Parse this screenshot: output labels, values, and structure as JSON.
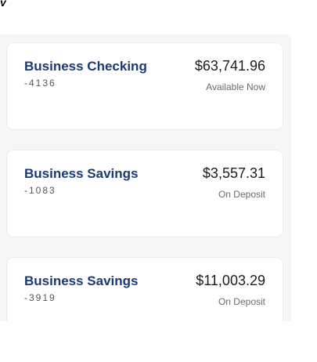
{
  "colors": {
    "account_name": "#1b3a73",
    "amount": "#1c1c1c",
    "muted": "#6c6c6c",
    "panel_bg": "#f6f6f7",
    "card_bg": "#ffffff"
  },
  "accounts": [
    {
      "name": "Business Checking",
      "number": "-4136",
      "amount": "$63,741.96",
      "status": "Available Now"
    },
    {
      "name": "Business Savings",
      "number": "-1083",
      "amount": "$3,557.31",
      "status": "On Deposit"
    },
    {
      "name": "Business Savings",
      "number": "-3919",
      "amount": "$11,003.29",
      "status": "On Deposit"
    }
  ]
}
